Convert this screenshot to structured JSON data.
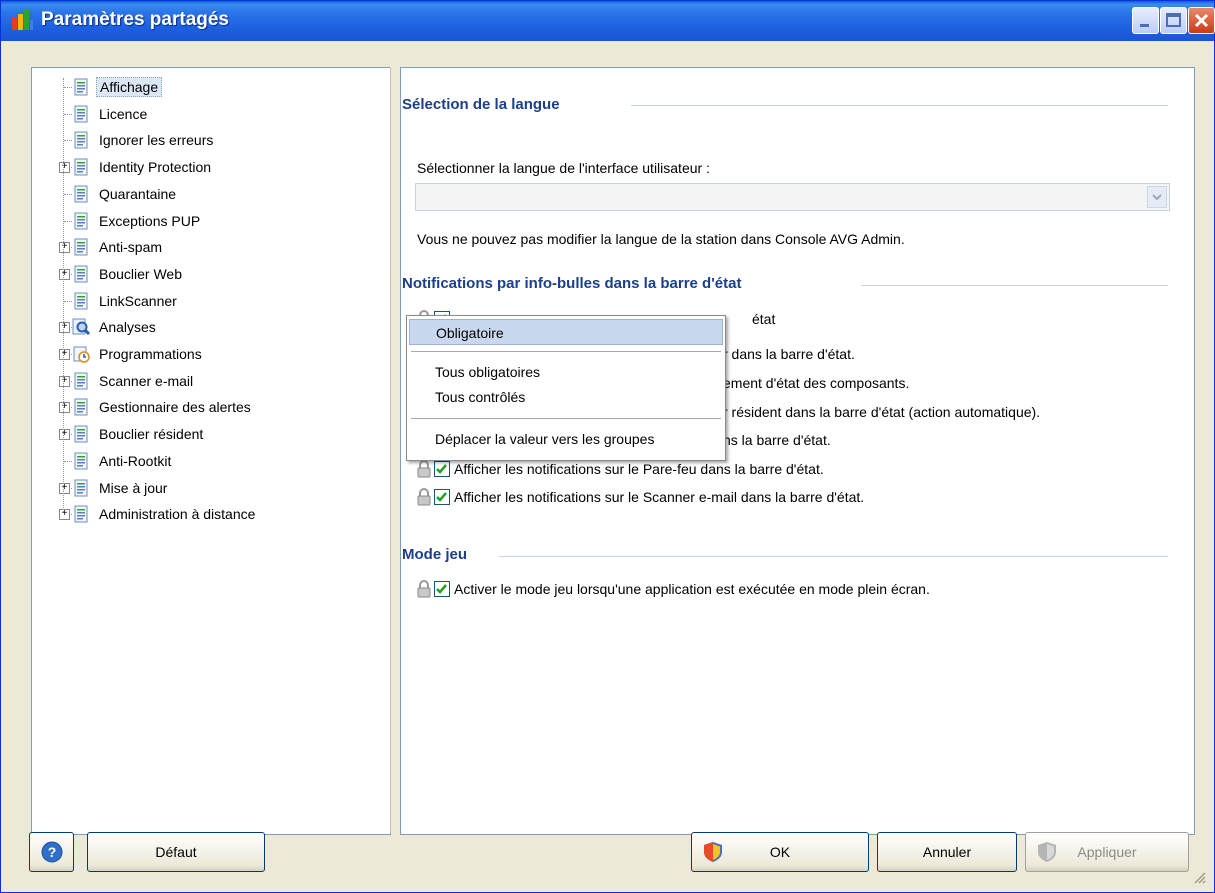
{
  "window": {
    "title": "Paramètres partagés"
  },
  "tree": {
    "items": [
      {
        "label": "Affichage",
        "expandable": false,
        "selected": true,
        "icon": "settings-page-icon"
      },
      {
        "label": "Licence",
        "expandable": false,
        "icon": "settings-page-icon"
      },
      {
        "label": "Ignorer les erreurs",
        "expandable": false,
        "icon": "settings-page-icon"
      },
      {
        "label": "Identity Protection",
        "expandable": true,
        "icon": "settings-page-icon"
      },
      {
        "label": "Quarantaine",
        "expandable": false,
        "icon": "settings-page-icon"
      },
      {
        "label": "Exceptions PUP",
        "expandable": false,
        "icon": "settings-page-icon"
      },
      {
        "label": "Anti-spam",
        "expandable": true,
        "icon": "settings-page-icon"
      },
      {
        "label": "Bouclier Web",
        "expandable": true,
        "icon": "settings-page-icon"
      },
      {
        "label": "LinkScanner",
        "expandable": false,
        "icon": "settings-page-icon"
      },
      {
        "label": "Analyses",
        "expandable": true,
        "icon": "magnifier-icon"
      },
      {
        "label": "Programmations",
        "expandable": true,
        "icon": "schedule-icon"
      },
      {
        "label": "Scanner e-mail",
        "expandable": true,
        "icon": "settings-page-icon"
      },
      {
        "label": "Gestionnaire des alertes",
        "expandable": true,
        "icon": "settings-page-icon"
      },
      {
        "label": "Bouclier résident",
        "expandable": true,
        "icon": "settings-page-icon"
      },
      {
        "label": "Anti-Rootkit",
        "expandable": false,
        "icon": "settings-page-icon"
      },
      {
        "label": "Mise à jour",
        "expandable": true,
        "icon": "settings-page-icon"
      },
      {
        "label": "Administration à distance",
        "expandable": true,
        "icon": "settings-page-icon"
      }
    ]
  },
  "panel": {
    "language_section": "Sélection de la langue",
    "language_label": "Sélectionner la langue de l'interface utilisateur :",
    "language_value": "",
    "language_note": "Vous ne pouvez pas modifier la langue de la station dans Console AVG Admin.",
    "notifications_section": "Notifications par info-bulles dans la barre d'état",
    "notifications": [
      {
        "label": "Afficher les notifications dans la barre d'état",
        "checked": true,
        "visible_fragment": "état"
      },
      {
        "label": "r dans la barre d'état.",
        "checked": true
      },
      {
        "label": "ement d'état des composants.",
        "checked": true
      },
      {
        "label": "r résident dans la barre d'état (action automatique).",
        "checked": true
      },
      {
        "label": "ns la barre d'état.",
        "checked": true
      },
      {
        "label": "Afficher les notifications sur le Pare-feu dans la barre d'état.",
        "checked": true
      },
      {
        "label": "Afficher les notifications sur le Scanner e-mail dans la barre d'état.",
        "checked": true
      }
    ],
    "game_section": "Mode jeu",
    "game_option": {
      "label": "Activer le mode jeu lorsqu'une application est exécutée en mode plein écran.",
      "checked": true
    }
  },
  "context_menu": {
    "items": [
      "Obligatoire",
      "Tous obligatoires",
      "Tous contrôlés",
      "Déplacer la valeur vers les groupes"
    ],
    "highlighted": "Obligatoire"
  },
  "buttons": {
    "help_icon": "help-icon",
    "default": "Défaut",
    "ok": "OK",
    "cancel": "Annuler",
    "apply": "Appliquer"
  },
  "colors": {
    "title_bar": "#1d5fe0",
    "section_title": "#1b3f8b",
    "menu_highlight": "#c9d8ee",
    "checkbox_check": "#21a121"
  }
}
